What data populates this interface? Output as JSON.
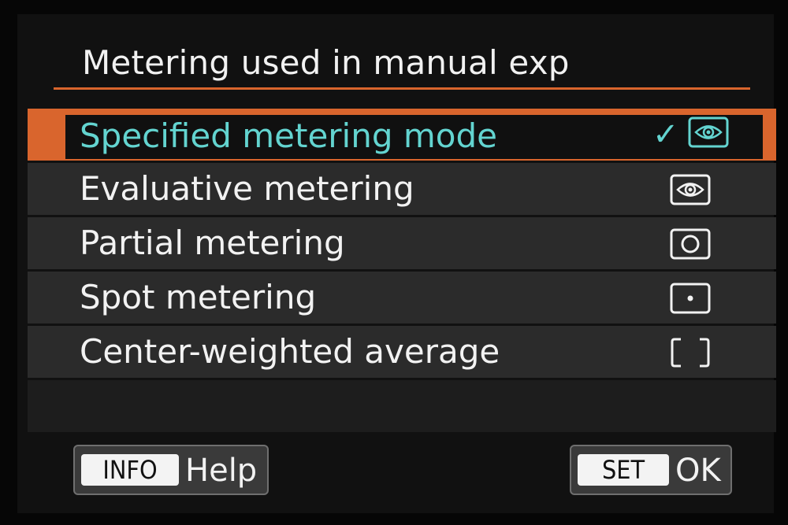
{
  "screen": {
    "title": "Metering used in manual exp"
  },
  "menu": {
    "items": [
      {
        "label": "Specified metering mode",
        "icon": "specified-metering-icon",
        "selected": true,
        "checked": true
      },
      {
        "label": "Evaluative metering",
        "icon": "evaluative-metering-icon",
        "selected": false
      },
      {
        "label": "Partial metering",
        "icon": "partial-metering-icon",
        "selected": false
      },
      {
        "label": "Spot metering",
        "icon": "spot-metering-icon",
        "selected": false
      },
      {
        "label": "Center-weighted average",
        "icon": "center-weighted-metering-icon",
        "selected": false
      }
    ],
    "check_mark": "✓"
  },
  "footer": {
    "info_key": "INFO",
    "info_label": "Help",
    "set_key": "SET",
    "set_label": "OK"
  },
  "colors": {
    "accent": "#d9652d",
    "selected_text": "#63d4d0",
    "text": "#f2f2f2",
    "row_bg": "#2b2b2b",
    "screen_bg": "#111111"
  }
}
